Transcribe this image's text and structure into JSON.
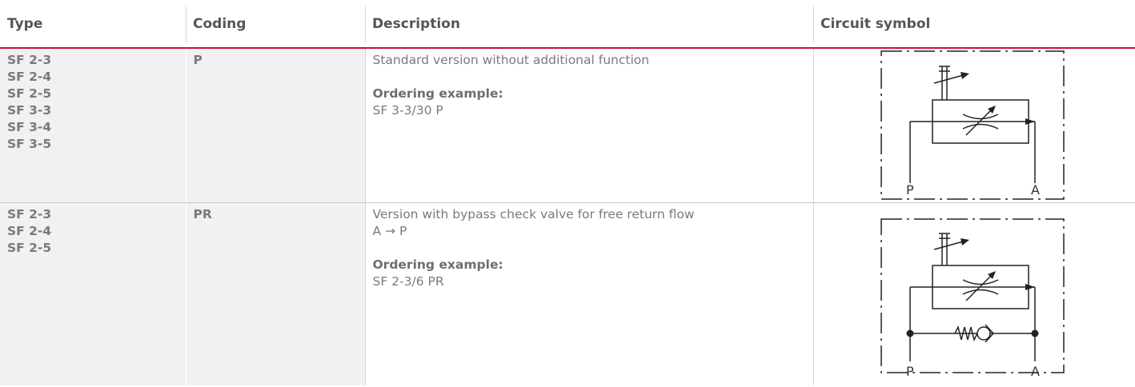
{
  "header": {
    "type": "Type",
    "coding": "Coding",
    "description": "Description",
    "circuit_symbol": "Circuit symbol"
  },
  "rows": [
    {
      "types": [
        "SF 2-3",
        "SF 2-4",
        "SF 2-5",
        "SF 3-3",
        "SF 3-4",
        "SF 3-5"
      ],
      "coding": "P",
      "description_lines": [
        "Standard version without additional function"
      ],
      "ordering_label": "Ordering example:",
      "ordering_value": "SF 3-3/30 P",
      "symbol": {
        "port_left": "P",
        "port_right": "A",
        "has_check_valve": false
      }
    },
    {
      "types": [
        "SF 2-3",
        "SF 2-4",
        "SF 2-5"
      ],
      "coding": "PR",
      "description_lines": [
        "Version with bypass check valve for free return flow",
        "A → P"
      ],
      "ordering_label": "Ordering example:",
      "ordering_value": "SF 2-3/6 PR",
      "symbol": {
        "port_left": "P",
        "port_right": "A",
        "has_check_valve": true
      }
    }
  ]
}
